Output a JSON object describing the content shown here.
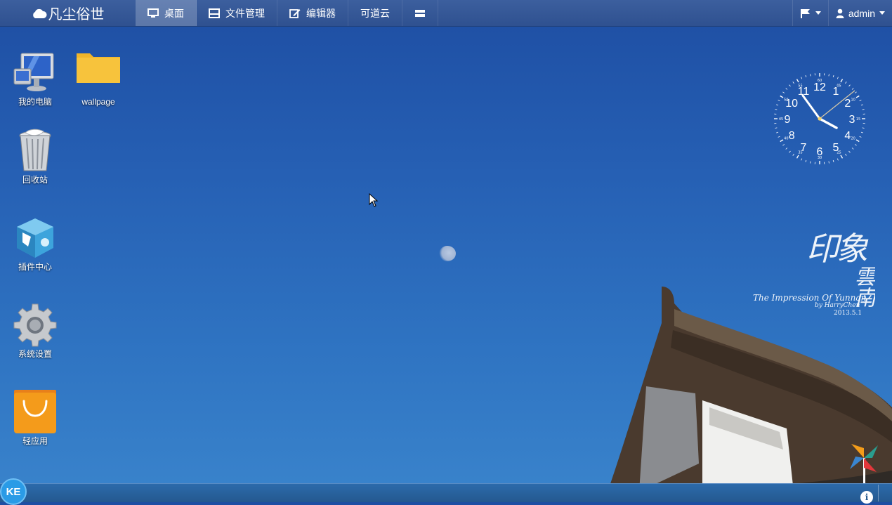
{
  "app": {
    "brand": "凡尘俗世",
    "brand_icon": "cloud-icon"
  },
  "nav": [
    {
      "label": "桌面",
      "icon": "desktop-icon",
      "active": true
    },
    {
      "label": "文件管理",
      "icon": "folder-manager-icon",
      "active": false
    },
    {
      "label": "编辑器",
      "icon": "edit-icon",
      "active": false
    },
    {
      "label": "可道云",
      "icon": "",
      "active": false
    },
    {
      "label": "",
      "icon": "layout-icon",
      "active": false
    }
  ],
  "user": {
    "name": "admin",
    "flag_icon": "flag-icon",
    "user_icon": "user-icon"
  },
  "desktop": {
    "icons": [
      {
        "label": "我的电脑",
        "icon": "computer-icon"
      },
      {
        "label": "wallpage",
        "icon": "folder-icon"
      },
      {
        "label": "回收站",
        "icon": "recycle-bin-icon"
      },
      {
        "label": "插件中心",
        "icon": "plugin-center-icon"
      },
      {
        "label": "系统设置",
        "icon": "settings-gear-icon"
      },
      {
        "label": "轻应用",
        "icon": "light-app-icon"
      }
    ]
  },
  "clock": {
    "numbers": [
      "12",
      "1",
      "2",
      "3",
      "4",
      "5",
      "6",
      "7",
      "8",
      "9",
      "10",
      "11"
    ],
    "minute_labels": [
      "60",
      "05",
      "10",
      "15",
      "20",
      "25",
      "30",
      "35",
      "40",
      "45",
      "50",
      "55"
    ]
  },
  "wallpaper": {
    "title_cn_1": "印象",
    "title_cn_2": "雲南",
    "title_en": "The Impression Of Yunnan",
    "author": "by HarryChen",
    "date": "2013.5.1"
  },
  "taskbar": {
    "start_label": "KE",
    "info_label": "i"
  },
  "colors": {
    "topbar": "#2f5190",
    "active_tab": "#5a78ad",
    "taskbar": "#24598f",
    "start_button": "#2a9be6",
    "folder": "#f7c33c",
    "light_app": "#f49b1b"
  }
}
